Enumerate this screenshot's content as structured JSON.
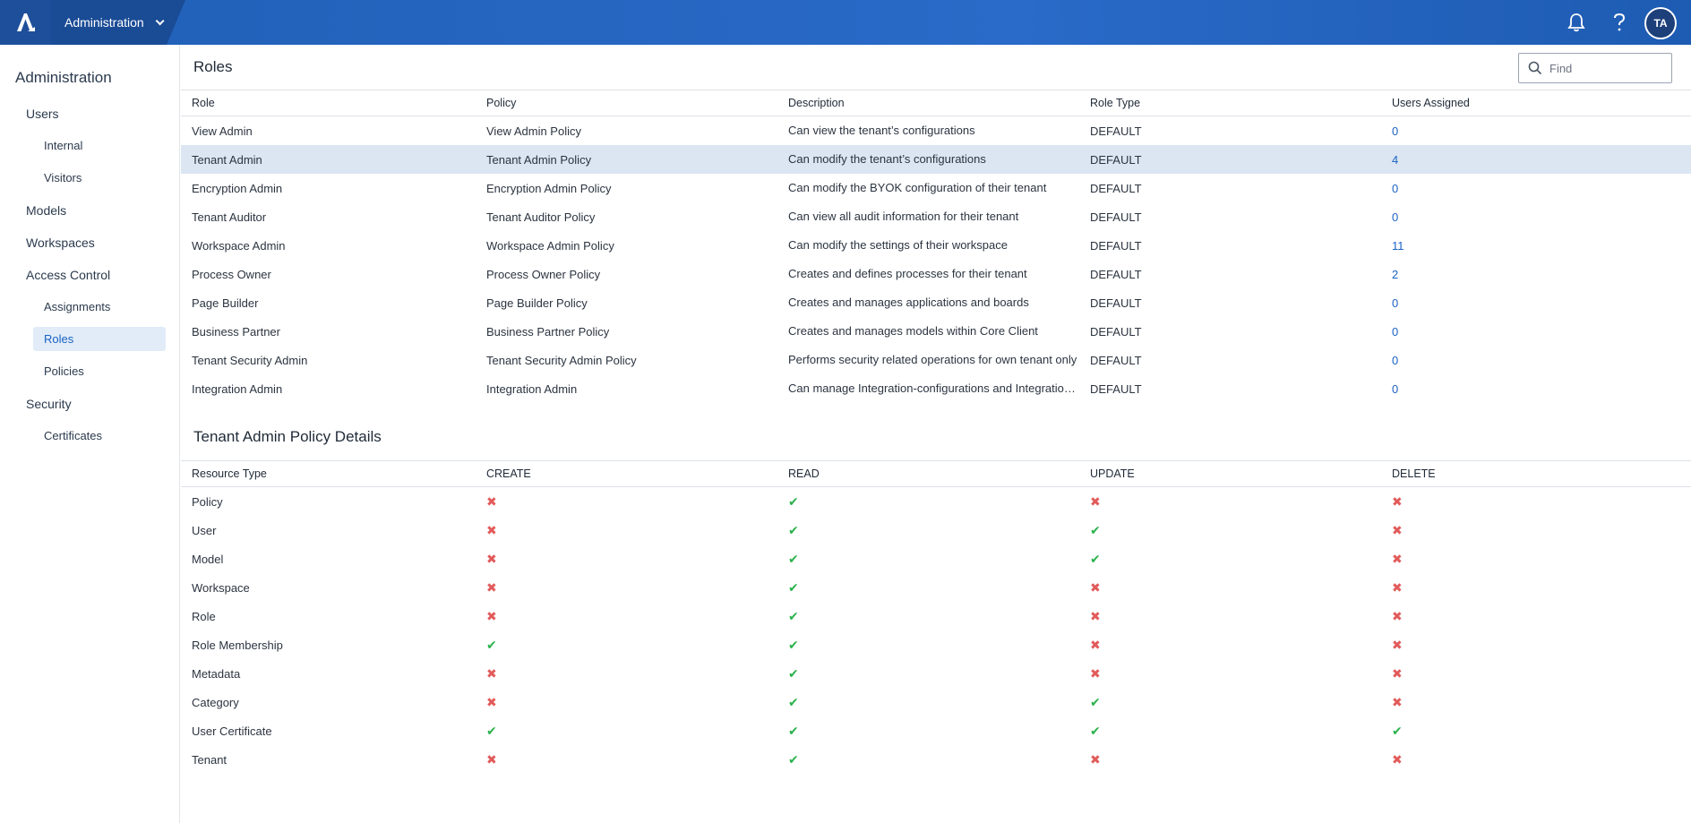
{
  "header": {
    "app_name": "Administration",
    "user_initials": "TA"
  },
  "sidebar": {
    "title": "Administration",
    "users": "Users",
    "internal": "Internal",
    "visitors": "Visitors",
    "models": "Models",
    "workspaces": "Workspaces",
    "access_control": "Access Control",
    "assignments": "Assignments",
    "roles": "Roles",
    "policies": "Policies",
    "security": "Security",
    "certificates": "Certificates"
  },
  "roles": {
    "title": "Roles",
    "find_placeholder": "Find",
    "columns": [
      "Role",
      "Policy",
      "Description",
      "Role Type",
      "Users Assigned"
    ],
    "rows": [
      {
        "role": "View Admin",
        "policy": "View Admin Policy",
        "description": "Can view the tenant’s configurations",
        "type": "DEFAULT",
        "users": "0"
      },
      {
        "role": "Tenant Admin",
        "policy": "Tenant Admin Policy",
        "description": "Can modify the tenant’s configurations",
        "type": "DEFAULT",
        "users": "4"
      },
      {
        "role": "Encryption Admin",
        "policy": "Encryption Admin Policy",
        "description": "Can modify the BYOK configuration of their tenant",
        "type": "DEFAULT",
        "users": "0"
      },
      {
        "role": "Tenant Auditor",
        "policy": "Tenant Auditor Policy",
        "description": "Can view all audit information for their tenant",
        "type": "DEFAULT",
        "users": "0"
      },
      {
        "role": "Workspace Admin",
        "policy": "Workspace Admin Policy",
        "description": "Can modify the settings of their workspace",
        "type": "DEFAULT",
        "users": "11"
      },
      {
        "role": "Process Owner",
        "policy": "Process Owner Policy",
        "description": "Creates and defines processes for their tenant",
        "type": "DEFAULT",
        "users": "2"
      },
      {
        "role": "Page Builder",
        "policy": "Page Builder Policy",
        "description": "Creates and manages applications and boards",
        "type": "DEFAULT",
        "users": "0"
      },
      {
        "role": "Business Partner",
        "policy": "Business Partner Policy",
        "description": "Creates and manages models within Core Client",
        "type": "DEFAULT",
        "users": "0"
      },
      {
        "role": "Tenant Security Admin",
        "policy": "Tenant Security Admin Policy",
        "description": "Performs security related operations for own tenant only",
        "type": "DEFAULT",
        "users": "0"
      },
      {
        "role": "Integration Admin",
        "policy": "Integration Admin",
        "description": "Can manage Integration-configurations and Integration-...",
        "type": "DEFAULT",
        "users": "0"
      }
    ]
  },
  "policy_details": {
    "title": "Tenant Admin Policy Details",
    "columns": [
      "Resource Type",
      "CREATE",
      "READ",
      "UPDATE",
      "DELETE"
    ],
    "rows": [
      {
        "resource": "Policy",
        "create": false,
        "read": true,
        "update": false,
        "delete": false
      },
      {
        "resource": "User",
        "create": false,
        "read": true,
        "update": true,
        "delete": false
      },
      {
        "resource": "Model",
        "create": false,
        "read": true,
        "update": true,
        "delete": false
      },
      {
        "resource": "Workspace",
        "create": false,
        "read": true,
        "update": false,
        "delete": false
      },
      {
        "resource": "Role",
        "create": false,
        "read": true,
        "update": false,
        "delete": false
      },
      {
        "resource": "Role Membership",
        "create": true,
        "read": true,
        "update": false,
        "delete": false
      },
      {
        "resource": "Metadata",
        "create": false,
        "read": true,
        "update": false,
        "delete": false
      },
      {
        "resource": "Category",
        "create": false,
        "read": true,
        "update": true,
        "delete": false
      },
      {
        "resource": "User Certificate",
        "create": true,
        "read": true,
        "update": true,
        "delete": true
      },
      {
        "resource": "Tenant",
        "create": false,
        "read": true,
        "update": false,
        "delete": false
      }
    ]
  },
  "colors": {
    "accent": "#1b63c4",
    "yes": "#2bb24c",
    "no": "#e25a5a",
    "selected_row": "#dbe6f2"
  }
}
